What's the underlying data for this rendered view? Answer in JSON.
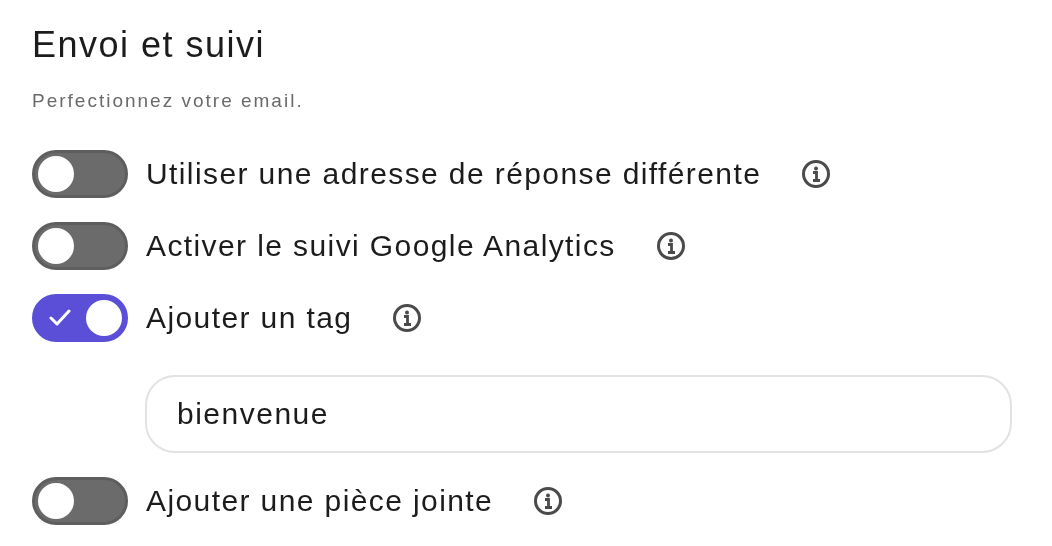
{
  "section": {
    "title": "Envoi et suivi",
    "subtitle": "Perfectionnez votre email."
  },
  "options": [
    {
      "label": "Utiliser une adresse de réponse différente",
      "on": false
    },
    {
      "label": "Activer le suivi Google Analytics",
      "on": false
    },
    {
      "label": "Ajouter un tag",
      "on": true,
      "field": {
        "value": "bienvenue"
      }
    },
    {
      "label": "Ajouter une pièce jointe",
      "on": false
    }
  ]
}
